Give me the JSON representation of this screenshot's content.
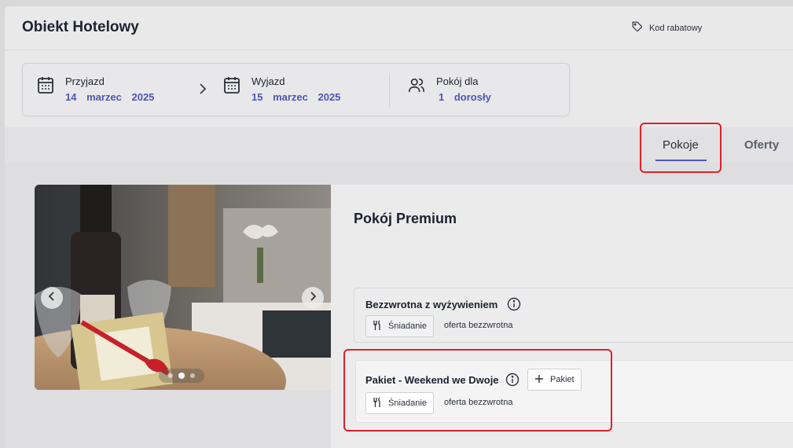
{
  "header": {
    "title": "Obiekt Hotelowy",
    "discount_label": "Kod rabatowy"
  },
  "booking": {
    "checkin_label": "Przyjazd",
    "checkin_value": "14 marzec 2025",
    "checkout_label": "Wyjazd",
    "checkout_value": "15 marzec 2025",
    "guests_label": "Pokój dla",
    "guests_value": "1 dorosły"
  },
  "tabs": {
    "rooms": "Pokoje",
    "offers": "Oferty",
    "active": "Pokoje"
  },
  "room": {
    "title": "Pokój Premium",
    "carousel": {
      "slides": 3,
      "active_slide": 2
    },
    "offers": [
      {
        "name": "Bezzwrotna z wyżywieniem",
        "meal_chip": "Śniadanie",
        "policy": "oferta bezzwrotna"
      },
      {
        "name": "Pakiet - Weekend we Dwoje",
        "package_button": "Pakiet",
        "meal_chip": "Śniadanie",
        "policy": "oferta bezzwrotna"
      }
    ]
  },
  "colors": {
    "accent": "#4c56b5",
    "highlight": "#e0202a"
  },
  "icons": [
    "tag-icon",
    "calendar-icon",
    "chevron-right-icon",
    "users-icon",
    "info-icon",
    "utensils-icon",
    "plus-icon",
    "chevron-left-icon"
  ]
}
